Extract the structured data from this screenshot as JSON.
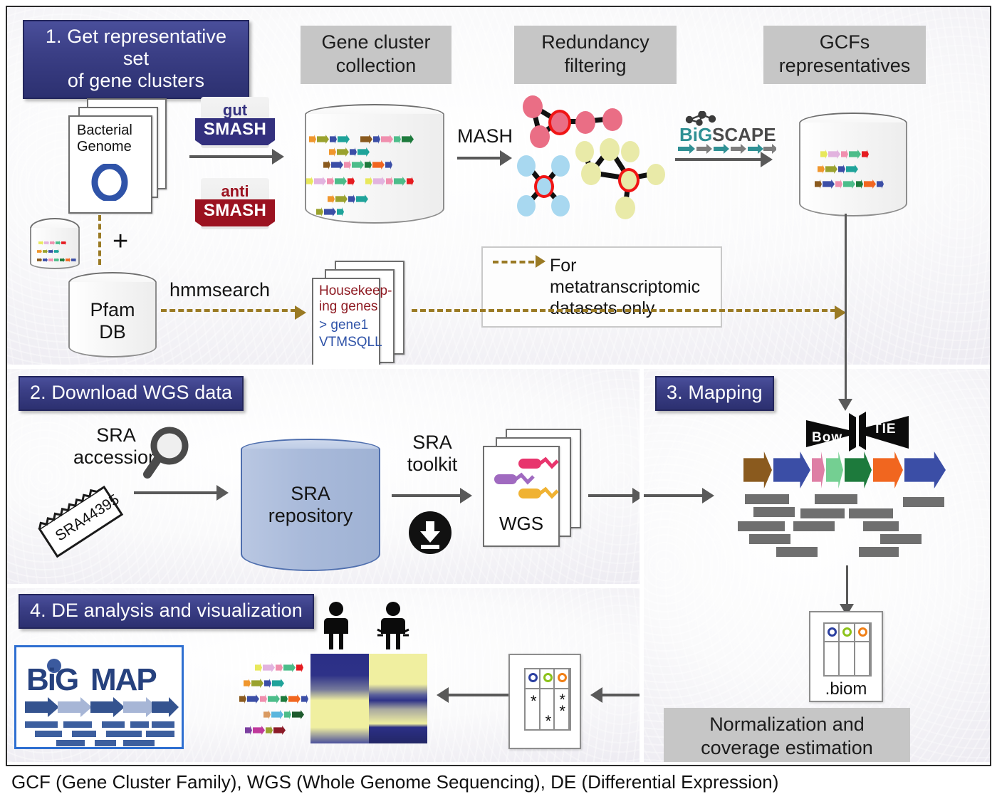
{
  "figure": {
    "caption": "GCF (Gene Cluster Family), WGS (Whole Genome Sequencing), DE (Differential Expression)"
  },
  "steps": {
    "step1": "1. Get representative set\nof gene clusters",
    "step2": "2. Download WGS data",
    "step3": "3. Mapping",
    "step4": "4. DE analysis and visualization"
  },
  "section1": {
    "headers": {
      "gene_cluster_collection": "Gene cluster\ncollection",
      "redundancy_filtering": "Redundancy\nfiltering",
      "gcfs_representatives": "GCFs\nrepresentatives"
    },
    "bacterial_genome_label": "Bacterial\nGenome",
    "tools": {
      "gut_prefix": "gut",
      "gut_main": "SMASH",
      "anti_prefix": "anti",
      "anti_main": "SMASH",
      "bigscape_big": "BiG",
      "bigscape_scape": "SCAPE"
    },
    "mash_label": "MASH",
    "pfam_label": "Pfam\nDB",
    "plus_symbol": "+",
    "hmmsearch_label": "hmmsearch",
    "housekeeping_title": "Housekeep-\ning genes",
    "housekeeping_seq_header": "> gene1",
    "housekeeping_seq": "VTMSQLL",
    "note": "For metatranscriptomic\ndatasets only"
  },
  "section2": {
    "sra_accession_label": "SRA\naccession",
    "ticket_label": "SRA44395",
    "sra_repository_label": "SRA\nrepository",
    "sra_toolkit_label": "SRA\ntoolkit",
    "wgs_label": "WGS"
  },
  "section3": {
    "bowtie_left": "Bow",
    "bowtie_right": "TIE",
    "biom_label": ".biom",
    "normalization_label": "Normalization and\ncoverage estimation"
  },
  "section4": {
    "logo_big": "BiG",
    "logo_map": "MAP",
    "stars": [
      "*",
      "*",
      "*",
      "*"
    ]
  },
  "colors": {
    "step_badge": "#33307e",
    "gray_header": "#c6c6c6",
    "arrow_gray": "#595959",
    "dashed_gold": "#9a7a24",
    "sra_cylinder": "#a9bada",
    "network_pink": "#ea6e85",
    "network_blue": "#a8d8f0",
    "network_yellow": "#e9eaa8",
    "network_selected_outline": "#f01515",
    "heatmap_low": "#2b2f86",
    "heatmap_high": "#f0efa0",
    "logo_blue": "#26417e",
    "ring_blue": "#2b3fa0",
    "ring_green": "#8cc21a",
    "ring_orange": "#f07f16"
  },
  "gene_clusters": {
    "collection_rows": [
      [
        "#f0962d",
        "#9aa22e",
        "#3b4ea6",
        "#1fa39a",
        "",
        "#8a5a1e",
        "#3b4ea6",
        "#f08fae",
        "#4cbd8a",
        "#1d7a3c"
      ],
      [
        "#f0962d",
        "#9aa22e",
        "#3b4ea6",
        "#1fa39a"
      ],
      [
        "#8a5a1e",
        "#3b4ea6",
        "#f08fae",
        "#4cbd8a",
        "#1d7a3c",
        "#f1661f",
        "#3b4ea6"
      ],
      [
        "#e8e85c",
        "#e2b3df",
        "#f08fae",
        "#4cbd8a",
        "#e51b20",
        "",
        "#e8e85c",
        "#e2b3df",
        "#f08fae",
        "#4cbd8a",
        "#e51b20"
      ],
      [
        "#f0962d",
        "#9aa22e",
        "#3b4ea6",
        "#1fa39a"
      ],
      [
        "#9aa22e",
        "#3b4ea6",
        "#1fa39a"
      ]
    ],
    "gcf_rows": [
      [
        "#e8e85c",
        "#e2b3df",
        "#f08fae",
        "#4cbd8a",
        "#e51b20"
      ],
      [
        "#f0962d",
        "#9aa22e",
        "#3b4ea6",
        "#1fa39a"
      ],
      [
        "#8a5a1e",
        "#3b4ea6",
        "#f08fae",
        "#4cbd8a",
        "#1d7a3c",
        "#f1661f",
        "#3b4ea6"
      ]
    ],
    "mapping_operon": [
      "#8a5a1e",
      "#3b4ea6",
      "#de7fa5",
      "#74cf92",
      "#1d7a3c",
      "#f1661f",
      "#3b4ea6"
    ],
    "heatmap_rows": [
      [
        "#e8e85c",
        "#e2b3df",
        "#f08fae",
        "#4cbd8a",
        "#e51b20"
      ],
      [
        "#f0962d",
        "#9aa22e",
        "#3b4ea6",
        "#1fa39a"
      ],
      [
        "#8a5a1e",
        "#3b4ea6",
        "#f08fae",
        "#4cbd8a",
        "#1d7a3c",
        "#f1661f",
        "#3b4ea6"
      ],
      [
        "#d99a62",
        "#5bb6dd",
        "#4cbd8a",
        "#1d5a2c"
      ],
      [
        "#7b3fa0",
        "#c0399c",
        "#9aa22e",
        "#8b1a28"
      ]
    ]
  },
  "network": {
    "pink_nodes": 5,
    "blue_nodes": 5,
    "yellow_nodes": 7,
    "selected_count": 3
  }
}
